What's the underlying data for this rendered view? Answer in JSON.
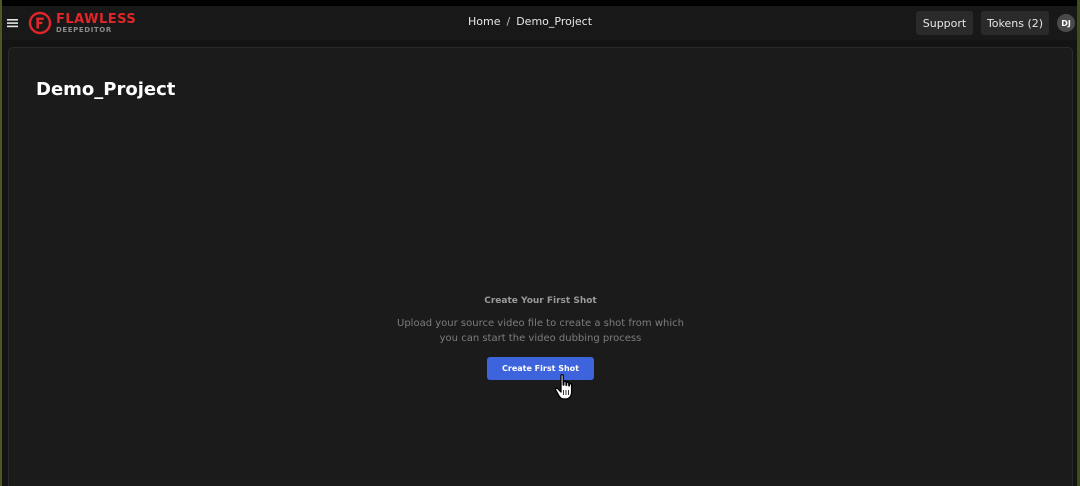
{
  "header": {
    "logo": {
      "main": "FLAWLESS",
      "sub": "DEEPEDITOR",
      "color": "#e0262b"
    },
    "breadcrumb": {
      "home": "Home",
      "separator": "/",
      "current": "Demo_Project"
    },
    "support_label": "Support",
    "tokens_label": "Tokens (2)",
    "avatar_initials": "DJ"
  },
  "main": {
    "title": "Demo_Project",
    "empty_state": {
      "title": "Create Your First Shot",
      "description": "Upload your source video file to create a shot from which you can start the video dubbing process",
      "cta_label": "Create First Shot"
    }
  },
  "colors": {
    "background": "#141414",
    "panel": "#1b1b1b",
    "accent": "#3d63dd"
  },
  "icons": {
    "menu": "hamburger-menu-icon",
    "logo": "flawless-logo-icon",
    "cursor": "hand-pointer-cursor-icon"
  }
}
